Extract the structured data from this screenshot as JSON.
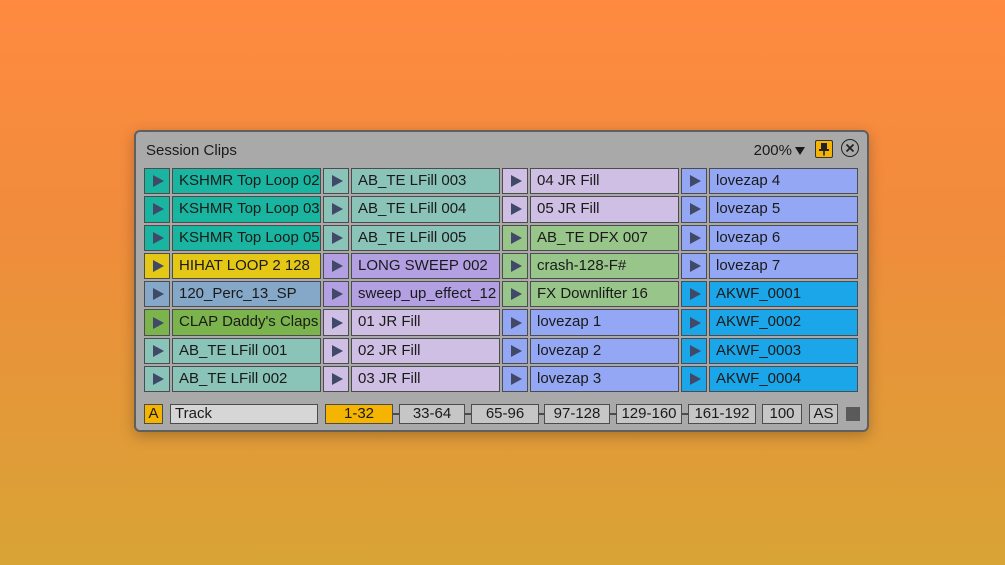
{
  "window": {
    "title": "Session Clips",
    "zoom": "200%",
    "pin_icon": "pin-icon",
    "close_icon": "close-icon"
  },
  "columns": [
    [
      {
        "label": "KSHMR Top Loop 02",
        "color": "#1ab5a0"
      },
      {
        "label": "KSHMR Top Loop 03",
        "color": "#1ab5a0"
      },
      {
        "label": "KSHMR Top Loop 05",
        "color": "#1ab5a0"
      },
      {
        "label": "HIHAT LOOP 2  128",
        "color": "#e5c716"
      },
      {
        "label": "120_Perc_13_SP",
        "color": "#86a8c8"
      },
      {
        "label": "CLAP Daddy's Claps",
        "color": "#7bb34c"
      },
      {
        "label": "AB_TE LFill 001",
        "color": "#8ac3b8"
      },
      {
        "label": "AB_TE LFill 002",
        "color": "#8ac3b8"
      }
    ],
    [
      {
        "label": "AB_TE LFill 003",
        "color": "#8ac3b8"
      },
      {
        "label": "AB_TE LFill 004",
        "color": "#8ac3b8"
      },
      {
        "label": "AB_TE LFill 005",
        "color": "#8ac3b8"
      },
      {
        "label": "LONG SWEEP 002",
        "color": "#b2a0e3"
      },
      {
        "label": "sweep_up_effect_12",
        "color": "#b2a0e3"
      },
      {
        "label": "01 JR Fill",
        "color": "#cfbfe4"
      },
      {
        "label": "02 JR Fill",
        "color": "#cfbfe4"
      },
      {
        "label": "03 JR Fill",
        "color": "#cfbfe4"
      }
    ],
    [
      {
        "label": "04 JR Fill",
        "color": "#cfbfe4"
      },
      {
        "label": "05 JR Fill",
        "color": "#cfbfe4"
      },
      {
        "label": "AB_TE DFX 007",
        "color": "#98c58a"
      },
      {
        "label": "crash-128-F#",
        "color": "#98c58a"
      },
      {
        "label": "FX Downlifter 16",
        "color": "#98c58a"
      },
      {
        "label": "lovezap 1",
        "color": "#93a7f4"
      },
      {
        "label": "lovezap 2",
        "color": "#93a7f4"
      },
      {
        "label": "lovezap 3",
        "color": "#93a7f4"
      }
    ],
    [
      {
        "label": "lovezap 4",
        "color": "#93a7f4"
      },
      {
        "label": "lovezap 5",
        "color": "#93a7f4"
      },
      {
        "label": "lovezap 6",
        "color": "#93a7f4"
      },
      {
        "label": "lovezap 7",
        "color": "#93a7f4"
      },
      {
        "label": "AKWF_0001",
        "color": "#1aa6e8"
      },
      {
        "label": "AKWF_0002",
        "color": "#1aa6e8"
      },
      {
        "label": "AKWF_0003",
        "color": "#1aa6e8"
      },
      {
        "label": "AKWF_0004",
        "color": "#1aa6e8"
      }
    ]
  ],
  "footer": {
    "a_label": "A",
    "track_value": "Track",
    "pages": [
      "1-32",
      "33-64",
      "65-96",
      "97-128",
      "129-160",
      "161-192"
    ],
    "active_page": "1-32",
    "count": "100",
    "as_label": "AS",
    "accent": "#f5b400"
  }
}
